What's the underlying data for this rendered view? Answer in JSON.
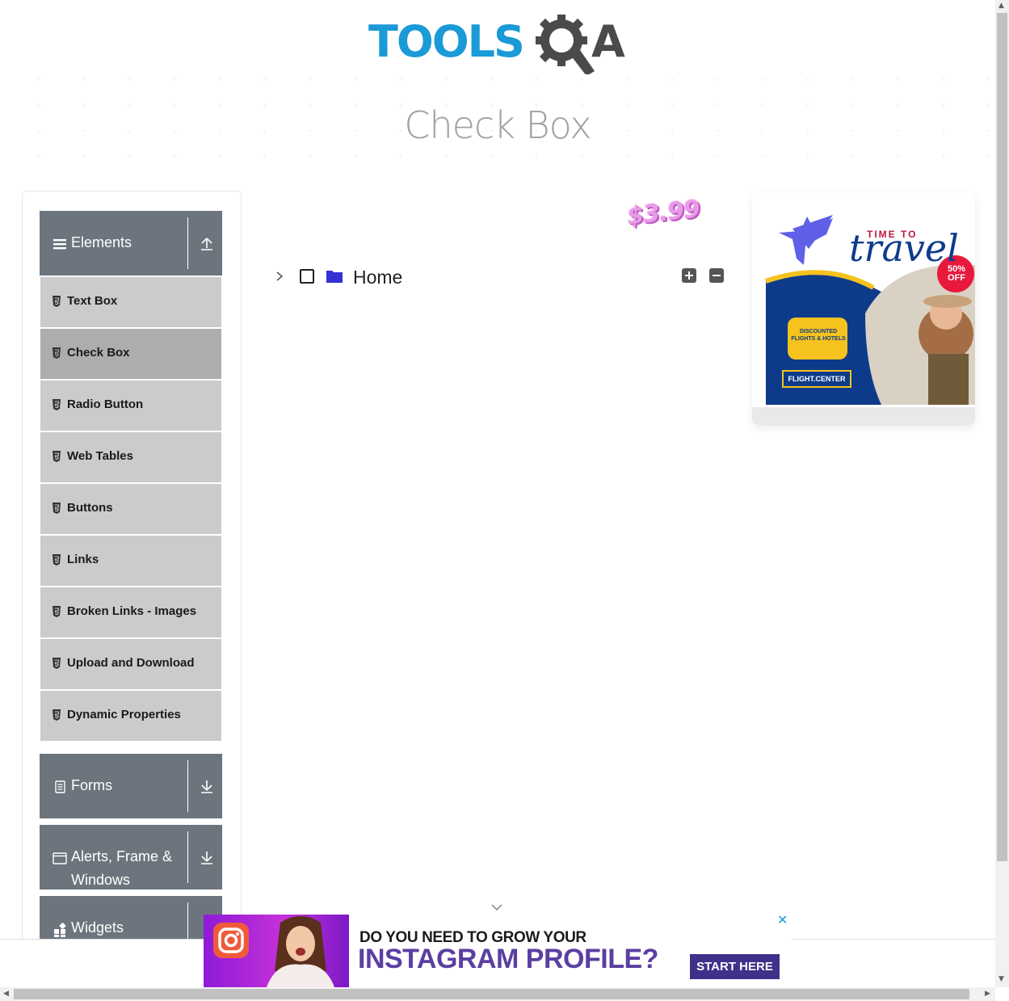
{
  "header": {
    "logo_text": "TOOLSQA",
    "logo_tools": "TOOLS",
    "logo_a": "A",
    "page_title": "Check Box"
  },
  "sidebar": {
    "groups": [
      {
        "label": "Elements",
        "icon": "hamburger-icon",
        "toggle": "collapse-up-icon"
      },
      {
        "label": "Forms",
        "icon": "document-icon",
        "toggle": "expand-down-icon"
      },
      {
        "label_line1": "Alerts, Frame &",
        "label_line2": "Windows",
        "icon": "window-icon",
        "toggle": "expand-down-icon"
      },
      {
        "label": "Widgets",
        "icon": "widgets-icon"
      }
    ],
    "items": [
      {
        "label": "Text Box"
      },
      {
        "label": "Check Box",
        "active": true
      },
      {
        "label": "Radio Button"
      },
      {
        "label": "Web Tables"
      },
      {
        "label": "Buttons"
      },
      {
        "label": "Links"
      },
      {
        "label": "Broken Links - Images"
      },
      {
        "label": "Upload and Download"
      },
      {
        "label": "Dynamic Properties"
      }
    ]
  },
  "tree": {
    "root_label": "Home",
    "checked": false,
    "expanded": false,
    "folder_color": "#3330d6"
  },
  "promo": {
    "price": "$3.99"
  },
  "right_ad": {
    "headline_small": "TIME TO",
    "headline_script": "travel",
    "badge": "50% OFF",
    "bubble": "DISCOUNTED FLIGHTS & HOTELS",
    "brand": "FLIGHT.CENTER"
  },
  "bottom_ad": {
    "line1": "DO YOU NEED TO GROW YOUR",
    "line2": "INSTAGRAM PROFILE?",
    "cta": "START HERE",
    "close": "✕"
  },
  "colors": {
    "accent": "#1a9ad6",
    "sidebar_header": "#6c757d",
    "menu_item": "#cbcbcb",
    "menu_item_active": "#adadad"
  }
}
